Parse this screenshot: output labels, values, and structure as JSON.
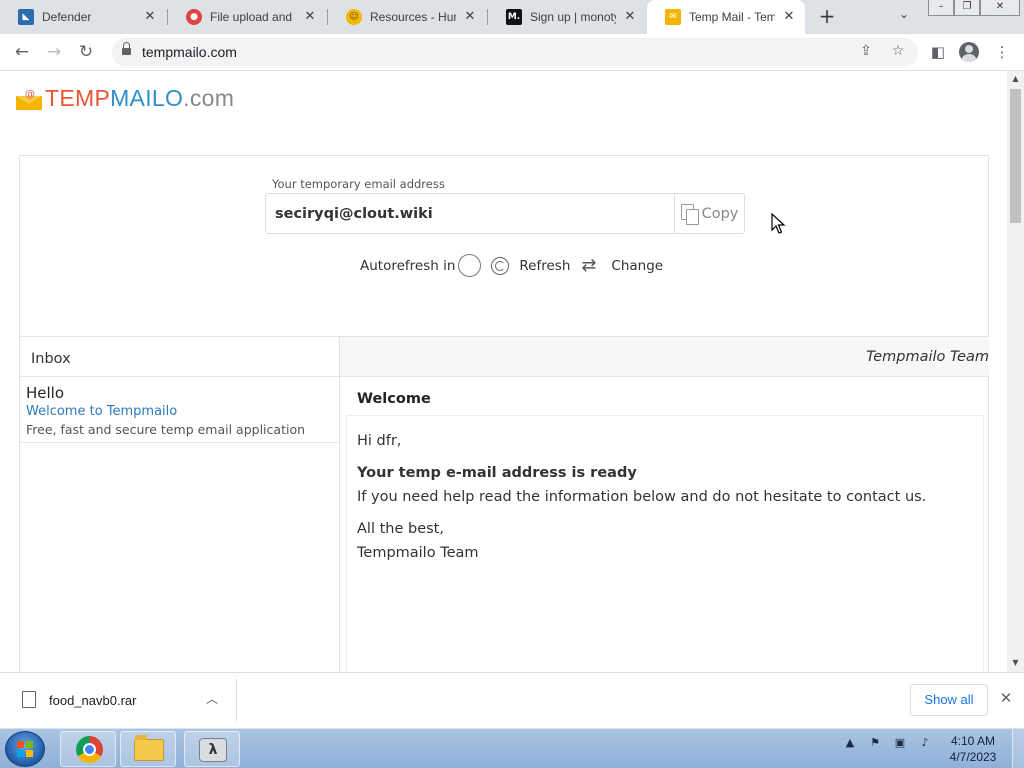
{
  "browser": {
    "tabs": [
      {
        "title": "Defender",
        "favicon": "defender-icon",
        "color": "#2b6cb0"
      },
      {
        "title": "File upload and sh",
        "favicon": "upload-icon",
        "color": "#e04343"
      },
      {
        "title": "Resources - Hung",
        "favicon": "smiley-icon",
        "color": "#f5b400"
      },
      {
        "title": "Sign up | monoty",
        "favicon": "monotype-icon",
        "color": "#111111"
      },
      {
        "title": "Temp Mail - Temp",
        "favicon": "envelope-icon",
        "color": "#f5b400",
        "active": true
      }
    ],
    "url": "tempmailo.com"
  },
  "page": {
    "logo": {
      "part1": "TEMP",
      "part2": "MAILO",
      "part3": ".com",
      "at": "@"
    },
    "email_label": "Your temporary email address",
    "email_address": "seciryqi@clout.wiki",
    "copy_label": "Copy",
    "autorefresh_label": "Autorefresh in",
    "refresh_label": "Refresh",
    "change_label": "Change",
    "inbox_title": "Inbox",
    "message_from_header": "Tempmailo Team",
    "inbox_items": [
      {
        "from": "Hello",
        "subject": "Welcome to Tempmailo",
        "preview": "Free, fast and secure temp email application"
      }
    ],
    "message": {
      "subject": "Welcome",
      "greeting": "Hi dfr,",
      "headline": "Your temp e-mail address is ready",
      "body": "If you need help read the information below and do not hesitate to contact us.",
      "signoff": "All the best,",
      "signature": "Tempmailo Team"
    }
  },
  "download_bar": {
    "filename": "food_navb0.rar",
    "show_all": "Show all"
  },
  "taskbar": {
    "time": "4:10 AM",
    "date": "4/7/2023"
  },
  "colors": {
    "logo_orange": "#e8563a",
    "logo_blue": "#2e8fc9",
    "link_blue": "#2d7ab8",
    "accent_blue": "#1a73e8"
  }
}
